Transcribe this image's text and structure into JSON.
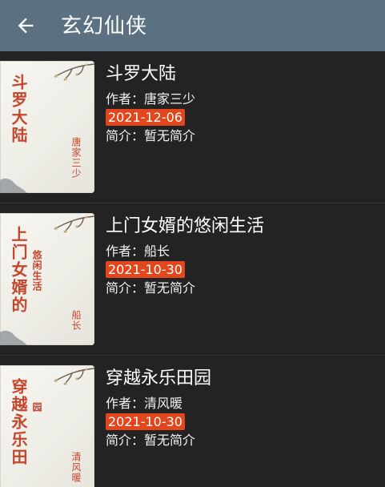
{
  "header": {
    "title": "玄幻仙侠",
    "back_icon": "arrow-left-icon"
  },
  "colors": {
    "toolbar": "#5b7182",
    "background": "#232323",
    "badge": "#e2461d",
    "cover_text": "#c4462d"
  },
  "books": [
    {
      "title": "斗罗大陆",
      "author_line": "作者：唐家三少",
      "date": "2021-12-06",
      "intro_line": "简介：暂无简介",
      "cover": {
        "title": "斗罗大陆",
        "subtitle": "",
        "author": "唐家三少"
      }
    },
    {
      "title": "上门女婿的悠闲生活",
      "author_line": "作者：船长",
      "date": "2021-10-30",
      "intro_line": "简介：暂无简介",
      "cover": {
        "title": "上门女婿的",
        "subtitle": "悠闲生活",
        "author": "船长"
      }
    },
    {
      "title": "穿越永乐田园",
      "author_line": "作者：清风暖",
      "date": "2021-10-30",
      "intro_line": "简介：暂无简介",
      "cover": {
        "title": "穿越永乐田",
        "subtitle": "园",
        "author": "清风暖"
      }
    }
  ]
}
